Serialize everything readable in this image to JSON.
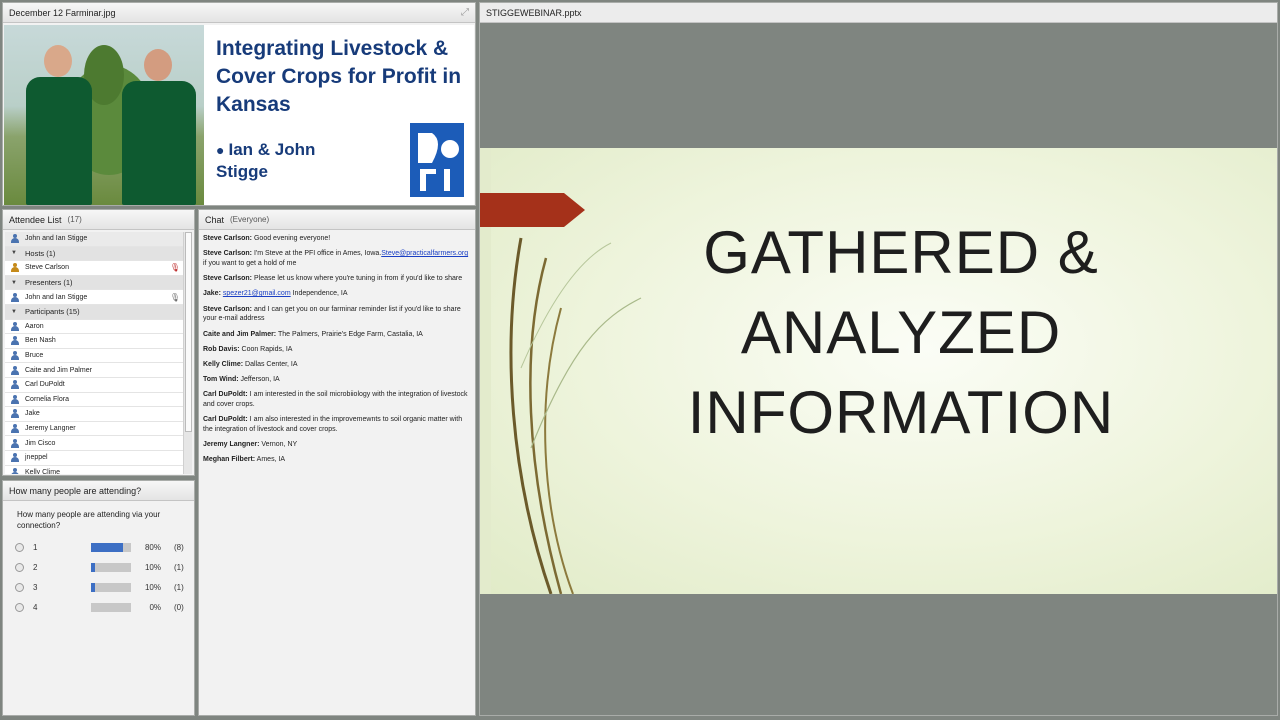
{
  "image_pod": {
    "title": "December 12 Farminar.jpg",
    "hero_title": "Integrating Livestock & Cover Crops for Profit in Kansas",
    "hero_presenters": "Ian & John Stigge"
  },
  "attendee_pod": {
    "title": "Attendee List",
    "count": "(17)",
    "pinned": "John and Ian Stigge",
    "groups": [
      {
        "label": "Hosts (1)",
        "members": [
          "Steve Carlson"
        ]
      },
      {
        "label": "Presenters (1)",
        "members": [
          "John and Ian Stigge"
        ]
      },
      {
        "label": "Participants (15)",
        "members": [
          "Aaron",
          "Ben Nash",
          "Bruce",
          "Caite and Jim Palmer",
          "Carl DuPoldt",
          "Cornelia Flora",
          "Jake",
          "Jeremy Langner",
          "Jim Cisco",
          "jneppel",
          "Kelly Clime"
        ]
      }
    ]
  },
  "poll_pod": {
    "header": "How many people are attending?",
    "question": "How many people are attending via your connection?",
    "options": [
      {
        "label": "1",
        "pct": "80%",
        "count": "(8)",
        "fraction": 0.8
      },
      {
        "label": "2",
        "pct": "10%",
        "count": "(1)",
        "fraction": 0.1
      },
      {
        "label": "3",
        "pct": "10%",
        "count": "(1)",
        "fraction": 0.1
      },
      {
        "label": "4",
        "pct": "0%",
        "count": "(0)",
        "fraction": 0
      }
    ]
  },
  "chat_pod": {
    "title": "Chat",
    "scope": "(Everyone)",
    "messages": [
      {
        "sender": "Steve Carlson:",
        "text": " Good evening everyone!"
      },
      {
        "sender": "Steve Carlson:",
        "text": " I'm Steve at the PFI office in Ames, Iowa.",
        "link": "Steve@practicalfarmers.org",
        "after": " if you want to get a hold of me"
      },
      {
        "sender": "Steve Carlson:",
        "text": " Please let us know where you're tuning in from if you'd like to share"
      },
      {
        "sender": "Jake:",
        "text": " ",
        "link": "spezer21@gmail.com",
        "after": " Independence, IA"
      },
      {
        "sender": "Steve Carlson:",
        "text": " and I can get you on our farminar reminder list if you'd like to share your e-mail address"
      },
      {
        "sender": "Caite and Jim Palmer:",
        "text": " The Palmers, Prairie's Edge Farm, Castalia, IA"
      },
      {
        "sender": "Rob Davis:",
        "text": " Coon Rapids, IA"
      },
      {
        "sender": "Kelly Clime:",
        "text": " Dallas Center, IA"
      },
      {
        "sender": "Tom Wind:",
        "text": " Jefferson, IA"
      },
      {
        "sender": "Carl DuPoldt:",
        "text": " I am interested in the soil microbiiology with the integration of livestock and cover crops."
      },
      {
        "sender": "Carl DuPoldt:",
        "text": " I am also interested in the improvemewnts to soil organic matter with the integration of livestock and cover crops."
      },
      {
        "sender": "Jeremy Langner:",
        "text": " Vernon, NY"
      },
      {
        "sender": "Meghan Filbert:",
        "text": " Ames, IA"
      }
    ]
  },
  "slide_pod": {
    "title": "STIGGEWEBINAR.pptx",
    "slide_title_lines": [
      "GATHERED &",
      "ANALYZED",
      "INFORMATION"
    ]
  },
  "icons": {
    "fullscreen": "expand-icon",
    "mic_muted": "mic-muted-icon",
    "mic": "mic-icon"
  },
  "colors": {
    "hero_text": "#173b7a",
    "poll_bar": "#3d6fc4",
    "slide_arrow": "#a5311a",
    "link": "#1a3fc4"
  }
}
